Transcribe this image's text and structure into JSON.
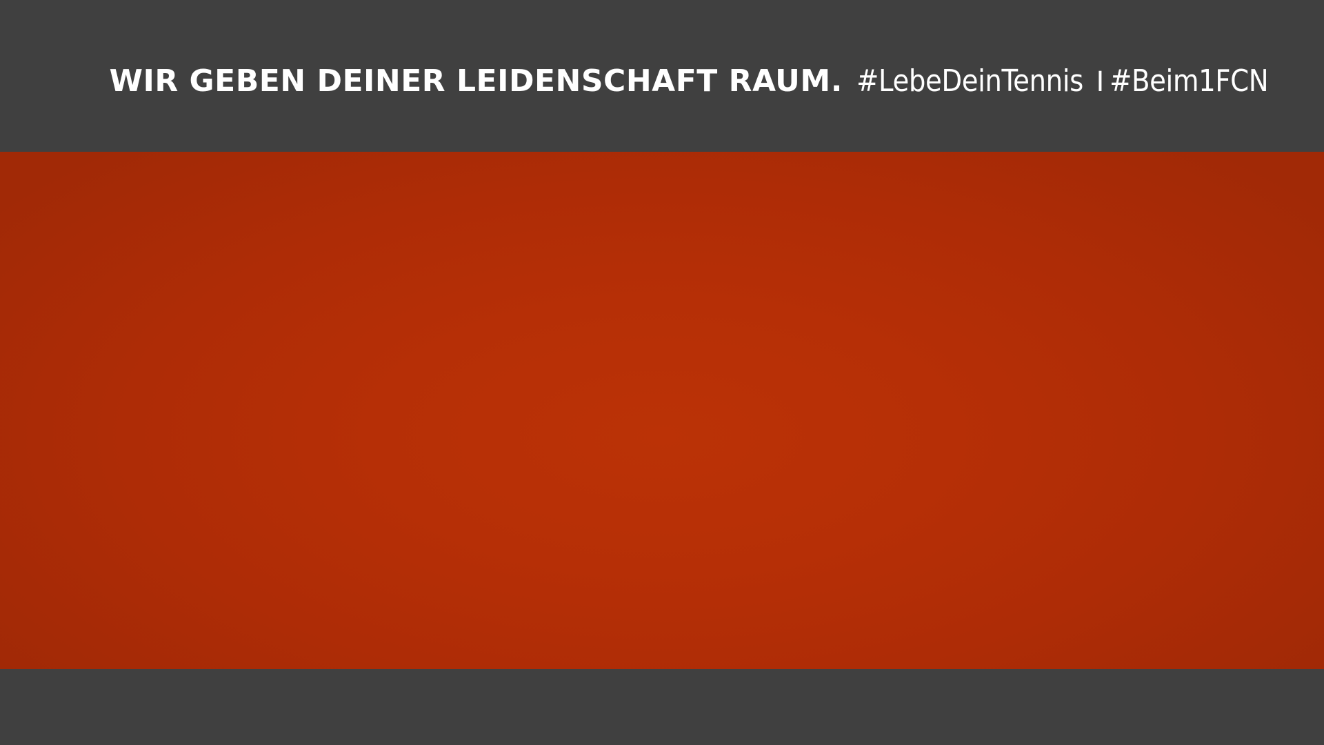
{
  "header": {
    "slogan": "WIR GEBEN DEINER LEIDENSCHAFT RAUM.",
    "hashtag_1": "#LebeDeinTennis",
    "separator": "I",
    "hashtag_2": "#Beim1FCN"
  },
  "colors": {
    "bar_background": "#404040",
    "court_clay": "#b52f06",
    "text": "#ffffff"
  }
}
